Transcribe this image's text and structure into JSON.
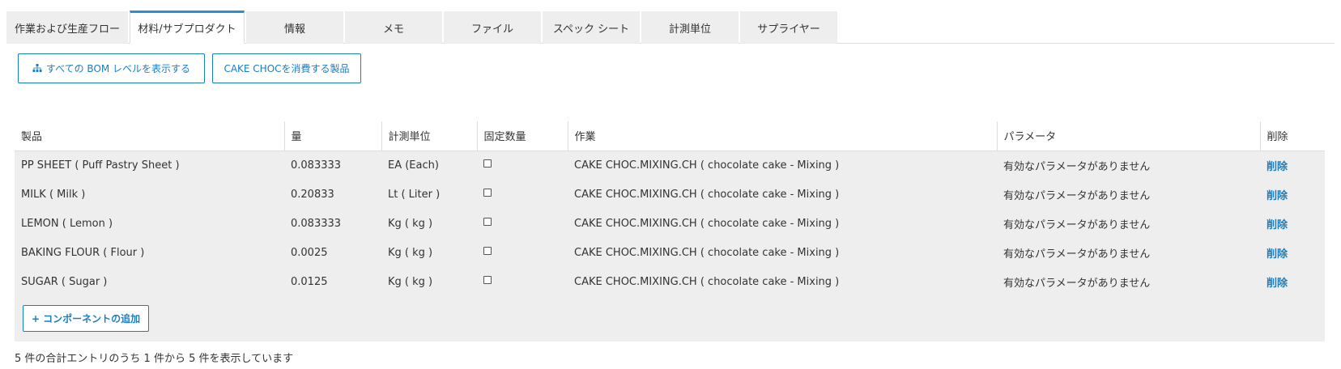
{
  "tabs": [
    "作業および生産フロー",
    "材料/サブプロダクト",
    "情報",
    "メモ",
    "ファイル",
    "スペック シート",
    "計測単位",
    "サプライヤー"
  ],
  "active_tab_index": 1,
  "actions": {
    "show_bom_levels": "すべての BOM レベルを表示する",
    "products_consuming": "CAKE CHOCを消費する製品",
    "bom_icon": "sitemap-icon"
  },
  "table": {
    "headers": [
      "製品",
      "量",
      "計測単位",
      "固定数量",
      "作業",
      "パラメータ",
      "削除"
    ],
    "rows": [
      {
        "product": "PP SHEET ( Puff Pastry Sheet )",
        "qty": "0.083333",
        "uom": "EA (Each)",
        "fixed": false,
        "operation": "CAKE CHOC.MIXING.CH ( chocolate cake - Mixing )",
        "params": "有効なパラメータがありません",
        "delete": "削除"
      },
      {
        "product": "MILK ( Milk )",
        "qty": "0.20833",
        "uom": "Lt ( Liter )",
        "fixed": false,
        "operation": "CAKE CHOC.MIXING.CH ( chocolate cake - Mixing )",
        "params": "有効なパラメータがありません",
        "delete": "削除"
      },
      {
        "product": "LEMON ( Lemon )",
        "qty": "0.083333",
        "uom": "Kg ( kg )",
        "fixed": false,
        "operation": "CAKE CHOC.MIXING.CH ( chocolate cake - Mixing )",
        "params": "有効なパラメータがありません",
        "delete": "削除"
      },
      {
        "product": "BAKING FLOUR ( Flour )",
        "qty": "0.0025",
        "uom": "Kg ( kg )",
        "fixed": false,
        "operation": "CAKE CHOC.MIXING.CH ( chocolate cake - Mixing )",
        "params": "有効なパラメータがありません",
        "delete": "削除"
      },
      {
        "product": "SUGAR ( Sugar )",
        "qty": "0.0125",
        "uom": "Kg ( kg )",
        "fixed": false,
        "operation": "CAKE CHOC.MIXING.CH ( chocolate cake - Mixing )",
        "params": "有効なパラメータがありません",
        "delete": "削除"
      }
    ],
    "add_component": "コンポーネントの追加"
  },
  "summary": "5 件の合計エントリのうち 1 件から 5 件を表示しています",
  "colors": {
    "accent": "#1a7fc1",
    "tab_active_border": "#2a8fd0",
    "row_bg": "#eeeeee"
  }
}
